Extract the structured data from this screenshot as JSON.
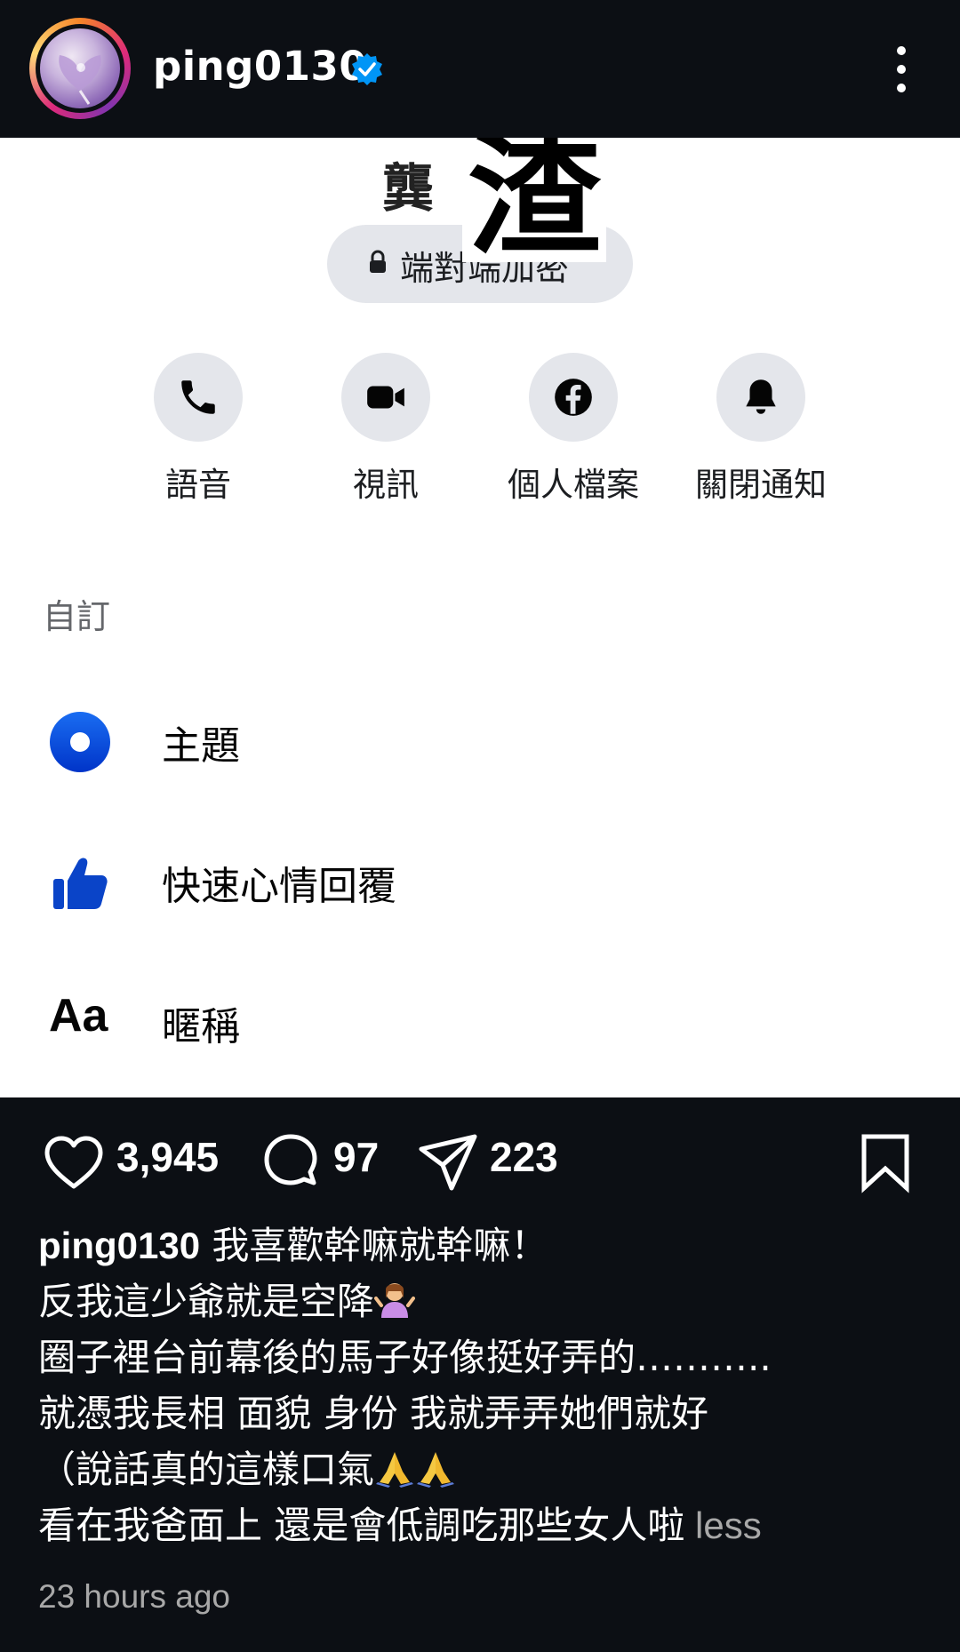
{
  "header": {
    "username": "ping0130",
    "verified_icon": "verified-badge-icon",
    "more_icon": "more-vertical-icon"
  },
  "screenshot": {
    "name_partial": "龔",
    "name_overlay_char": "渣",
    "encryption_label": "端對端加密",
    "actions": [
      {
        "label": "語音",
        "icon": "phone-icon"
      },
      {
        "label": "視訊",
        "icon": "video-camera-icon"
      },
      {
        "label": "個人檔案",
        "icon": "facebook-icon"
      },
      {
        "label": "關閉通知",
        "icon": "bell-icon"
      }
    ],
    "section_title": "自訂",
    "items": [
      {
        "label": "主題",
        "icon": "theme-icon"
      },
      {
        "label": "快速心情回覆",
        "icon": "thumbs-up-icon"
      },
      {
        "label": "暱稱",
        "icon_text": "Aa"
      }
    ],
    "colors": {
      "accent": "#0a4fd8",
      "pill": "#e4e6eb"
    }
  },
  "post_actions": {
    "likes": "3,945",
    "comments": "97",
    "shares": "223"
  },
  "caption": {
    "username": "ping0130",
    "line1": " 我喜歡幹嘛就幹嘛！",
    "line2": "反我這少爺就是空降",
    "line3": "圈子裡台前幕後的馬子好像挺好弄的………..",
    "line4": "就憑我長相 面貌 身份 我就弄弄她們就好",
    "line5": "（說話真的這樣口氣",
    "line6": "看在我爸面上 還是會低調吃那些女人啦",
    "less": " less"
  },
  "timestamp": "23 hours ago"
}
